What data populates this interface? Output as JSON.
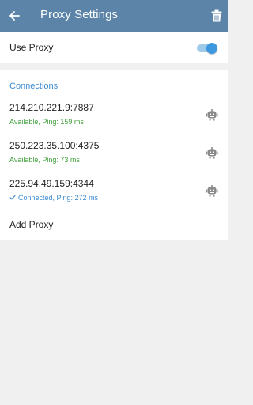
{
  "header": {
    "title": "Proxy Settings",
    "back_icon": "arrow-left-icon",
    "trash_icon": "trash-icon",
    "bg_color": "#5b84a8"
  },
  "use_proxy": {
    "label": "Use Proxy",
    "enabled": true,
    "accent": "#3c98df"
  },
  "connections": {
    "header": "Connections",
    "items": [
      {
        "address": "214.210.221.9:7887",
        "status": "Available, Ping: 159 ms",
        "connected": false
      },
      {
        "address": "250.223.35.100:4375",
        "status": "Available, Ping: 73 ms",
        "connected": false
      },
      {
        "address": "225.94.49.159:4344",
        "status": "Connected, Ping: 272 ms",
        "connected": true
      }
    ],
    "add_label": "Add Proxy",
    "status_available_color": "#3f9e3a",
    "status_connected_color": "#3d8bd0"
  }
}
